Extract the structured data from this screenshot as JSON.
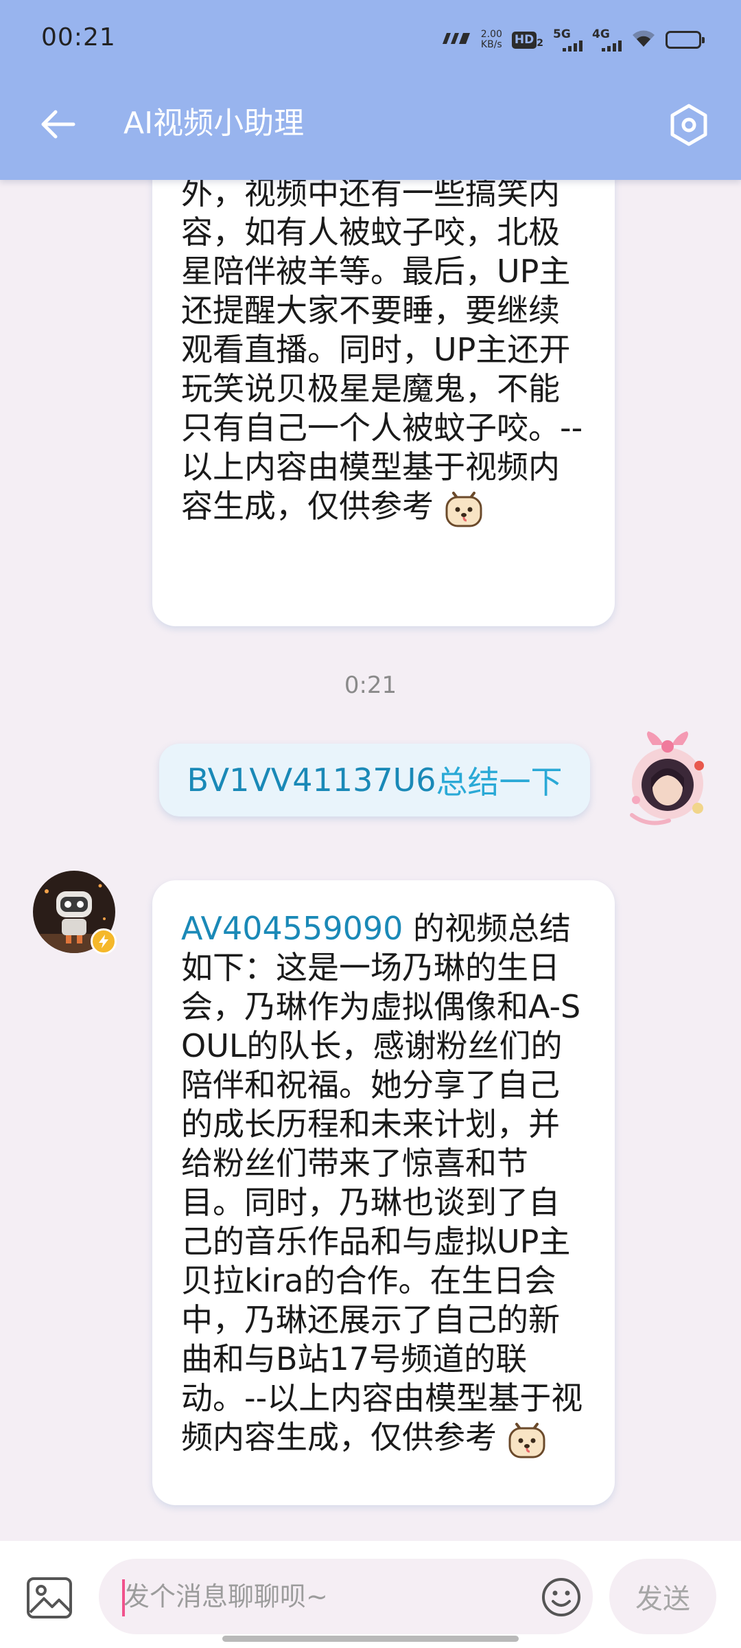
{
  "status_bar": {
    "time": "00:21",
    "net_speed_value": "2.00",
    "net_speed_unit": "KB/s",
    "hd_label": "HD",
    "hd_sub": "2",
    "sig1_label": "5G",
    "sig2_label": "4G",
    "icons": [
      "carrier-logo-icon",
      "hd-voice-icon",
      "signal-5g-icon",
      "signal-4g-icon",
      "wifi-icon",
      "battery-icon"
    ]
  },
  "app_bar": {
    "title": "AI视频小助理",
    "back_icon": "arrow-left-icon",
    "settings_icon": "hexagon-settings-icon"
  },
  "messages": [
    {
      "sender": "assistant",
      "text": "琴演奏音乐的个人技。此外，视频中还有一些搞笑内容，如有人被蚊子咬，北极星陪伴被羊等。最后，UP主还提醒大家不要睡，要继续观看直播。同时，UP主还开玩笑说贝极星是魔鬼，不能只有自己一个人被蚊子咬。--以上内容由模型基于视频内容生成，仅供参考",
      "sticker": "dog-face-sticker"
    },
    {
      "type": "timestamp",
      "text": "0:21"
    },
    {
      "sender": "user",
      "video_id": "BV1VV41137U6",
      "command": "总结一下"
    },
    {
      "sender": "assistant",
      "video_id": "AV404559090",
      "text": " 的视频总结如下：这是一场乃琳的生日会，乃琳作为虚拟偶像和A-SOUL的队长，感谢粉丝们的陪伴和祝福。她分享了自己的成长历程和未来计划，并给粉丝们带来了惊喜和节目。同时，乃琳也谈到了自己的音乐作品和与虚拟UP主贝拉kira的合作。在生日会中，乃琳还展示了自己的新曲和与B站17号频道的联动。--以上内容由模型基于视频内容生成，仅供参考",
      "sticker": "dog-face-sticker"
    }
  ],
  "composer": {
    "placeholder": "发个消息聊聊呗~",
    "value": "",
    "send_label": "发送",
    "image_icon": "image-icon",
    "emoji_icon": "smiley-icon"
  }
}
